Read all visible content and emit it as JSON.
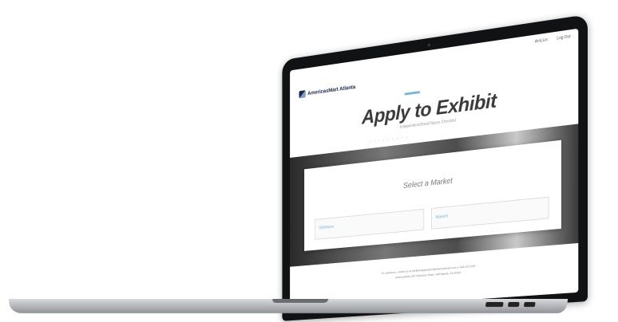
{
  "site": {
    "nav": {
      "link_1": "AmLLin",
      "link_2": "Log Out"
    },
    "logo": {
      "text": "AmericasMart Atlanta"
    },
    "headline": "Apply to Exhibit",
    "subhead": "Independent/Small Space Checklist",
    "card": {
      "title": "Select a Market",
      "option_1_label": "Gift/Home",
      "option_2_label": "Apparel"
    },
    "footer": {
      "line_1": "For questions, contact us at exhibitorapplication@americasmart.com or 404.220.2160",
      "line_2": "AmericasMart 240 Peachtree Street, NW Atlanta, GA 30303"
    }
  },
  "colors": {
    "accent": "#6db6e6",
    "brand": "#1c2a52"
  }
}
